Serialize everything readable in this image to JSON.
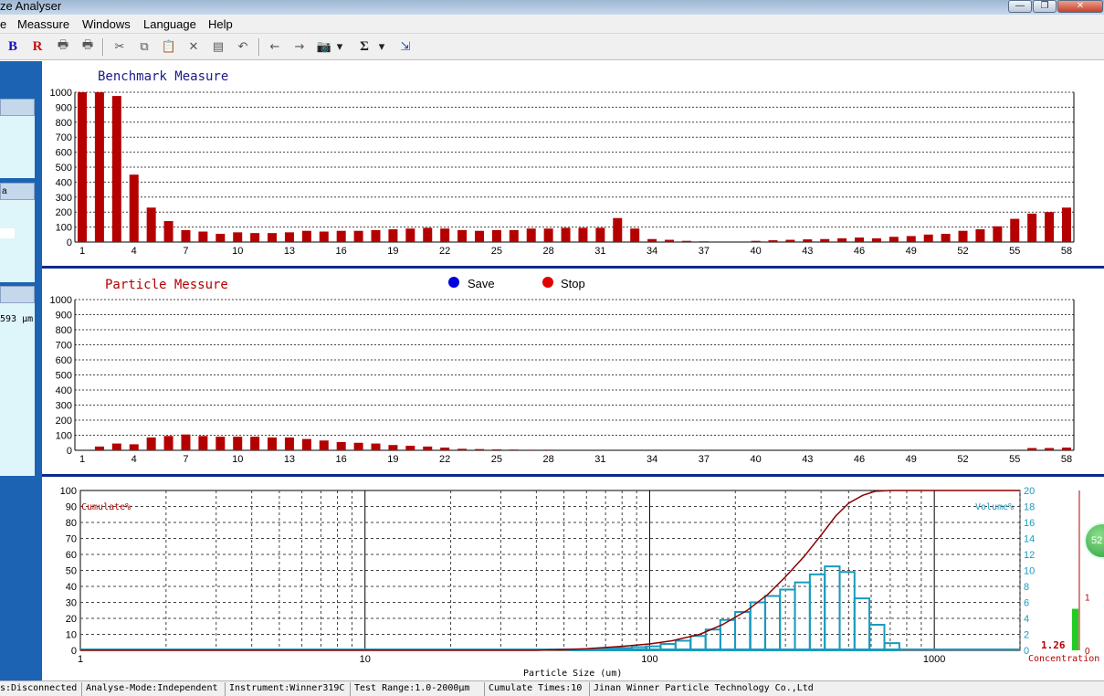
{
  "window": {
    "title": "ze Analyser",
    "buttons": [
      "—",
      "❐",
      "✕"
    ]
  },
  "menu": [
    "e",
    "Meassure",
    "Windows",
    "Language",
    "Help"
  ],
  "toolbar": [
    {
      "icon": "b-letter-icon",
      "label": "B"
    },
    {
      "icon": "r-letter-icon",
      "label": "R"
    },
    {
      "icon": "printer-icon",
      "label": "🖶"
    },
    {
      "icon": "printer-preview-icon",
      "label": "🖶"
    },
    {
      "icon": "cut-icon",
      "label": "✂"
    },
    {
      "icon": "copy-icon",
      "label": "⧉"
    },
    {
      "icon": "paste-icon",
      "label": "📋"
    },
    {
      "icon": "delete-icon",
      "label": "✕"
    },
    {
      "icon": "properties-icon",
      "label": "▤"
    },
    {
      "icon": "undo-icon",
      "label": "↶"
    },
    {
      "icon": "arrow-left-icon",
      "label": "←"
    },
    {
      "icon": "arrow-right-icon",
      "label": "→"
    },
    {
      "icon": "camera-icon",
      "label": "📷"
    },
    {
      "icon": "dropdown-arrow-icon",
      "label": "▾"
    },
    {
      "icon": "sigma-icon",
      "label": "Σ"
    },
    {
      "icon": "dropdown-arrow-icon",
      "label": "▾"
    },
    {
      "icon": "exit-icon",
      "label": "⇲"
    }
  ],
  "left_panel": {
    "head_2": "a",
    "size_text": "593 μm"
  },
  "benchmark": {
    "title": "Benchmark Measure",
    "title_color": "#1a1a8c",
    "bar_color": "#b50000",
    "y_ticks": [
      "0",
      "100",
      "200",
      "300",
      "400",
      "500",
      "600",
      "700",
      "800",
      "900",
      "1000"
    ],
    "x_ticks": [
      "1",
      "4",
      "7",
      "10",
      "13",
      "16",
      "19",
      "22",
      "25",
      "28",
      "31",
      "34",
      "37",
      "40",
      "43",
      "46",
      "49",
      "52",
      "55",
      "58"
    ]
  },
  "particle": {
    "title": "Particle Messure",
    "title_color": "#b50000",
    "save_label": "Save",
    "stop_label": "Stop",
    "save_color": "#0000e0",
    "stop_color": "#e00000",
    "y_ticks": [
      "0",
      "100",
      "200",
      "300",
      "400",
      "500",
      "600",
      "700",
      "800",
      "900",
      "1000"
    ],
    "x_ticks": [
      "1",
      "4",
      "7",
      "10",
      "13",
      "16",
      "19",
      "22",
      "25",
      "28",
      "31",
      "34",
      "37",
      "40",
      "43",
      "46",
      "49",
      "52",
      "55",
      "58"
    ]
  },
  "distribution": {
    "left_axis_label": "Cumulate%",
    "right_axis_label": "Volume%",
    "x_label": "Particle Size (um)",
    "left_ticks": [
      "0",
      "10",
      "20",
      "30",
      "40",
      "50",
      "60",
      "70",
      "80",
      "90",
      "100"
    ],
    "right_ticks": [
      "0",
      "2",
      "4",
      "6",
      "8",
      "10",
      "12",
      "14",
      "16",
      "18",
      "20"
    ],
    "x_ticks": [
      "1",
      "10",
      "100",
      "1000"
    ],
    "cumulate_color": "#8b0000",
    "volume_color": "#1a9bbf"
  },
  "concentration": {
    "value": "1.26",
    "label": "Concentration",
    "ticks": [
      "0",
      "1",
      "2"
    ],
    "bar_color": "#22cc22"
  },
  "green_badge": "52",
  "status": [
    "s:Disconnected",
    "Analyse-Mode:Independent",
    "Instrument:Winner319C",
    "Test Range:1.0-2000μm",
    "Cumulate Times:10",
    "Jinan Winner Particle Technology Co.,Ltd"
  ],
  "chart_data": [
    {
      "type": "bar",
      "title": "Benchmark Measure",
      "categories": [
        1,
        2,
        3,
        4,
        5,
        6,
        7,
        8,
        9,
        10,
        11,
        12,
        13,
        14,
        15,
        16,
        17,
        18,
        19,
        20,
        21,
        22,
        23,
        24,
        25,
        26,
        27,
        28,
        29,
        30,
        31,
        32,
        33,
        34,
        35,
        36,
        37,
        38,
        39,
        40,
        41,
        42,
        43,
        44,
        45,
        46,
        47,
        48,
        49,
        50,
        51,
        52,
        53,
        54,
        55,
        56,
        57,
        58
      ],
      "values": [
        1000,
        1000,
        975,
        450,
        230,
        140,
        80,
        70,
        55,
        65,
        60,
        60,
        65,
        75,
        70,
        75,
        75,
        80,
        85,
        90,
        95,
        90,
        80,
        75,
        80,
        80,
        90,
        90,
        95,
        95,
        95,
        160,
        90,
        20,
        15,
        8,
        5,
        3,
        3,
        8,
        12,
        15,
        18,
        20,
        25,
        30,
        25,
        35,
        40,
        50,
        55,
        75,
        85,
        105,
        155,
        190,
        200,
        230,
        295
      ],
      "ylim": [
        0,
        1000
      ]
    },
    {
      "type": "bar",
      "title": "Particle Messure",
      "categories": [
        1,
        2,
        3,
        4,
        5,
        6,
        7,
        8,
        9,
        10,
        11,
        12,
        13,
        14,
        15,
        16,
        17,
        18,
        19,
        20,
        21,
        22,
        23,
        24,
        25,
        26,
        27,
        28,
        29,
        30,
        31,
        32,
        33,
        34,
        35,
        36,
        37,
        38,
        39,
        40,
        41,
        42,
        43,
        44,
        45,
        46,
        47,
        48,
        49,
        50,
        51,
        52,
        53,
        54,
        55,
        56,
        57,
        58
      ],
      "values": [
        0,
        25,
        45,
        40,
        85,
        95,
        105,
        95,
        90,
        90,
        90,
        85,
        85,
        75,
        65,
        55,
        50,
        45,
        35,
        30,
        25,
        18,
        10,
        8,
        6,
        5,
        4,
        4,
        3,
        2,
        1,
        0,
        0,
        0,
        0,
        0,
        0,
        0,
        0,
        0,
        0,
        0,
        0,
        0,
        0,
        0,
        0,
        0,
        0,
        0,
        0,
        0,
        0,
        0,
        0,
        15,
        15,
        18,
        20
      ],
      "ylim": [
        0,
        1000
      ]
    },
    {
      "type": "bar",
      "title": "",
      "xlabel": "Particle Size (um)",
      "x_scale": "log",
      "xlim": [
        1,
        2000
      ],
      "series": [
        {
          "name": "Volume%",
          "axis": "right",
          "type": "histogram",
          "x": [
            56,
            64,
            72,
            81,
            92,
            103,
            116,
            131,
            148,
            167,
            188,
            212,
            240,
            270,
            305,
            344,
            388,
            438,
            494,
            557,
            629,
            710
          ],
          "values": [
            0.1,
            0.15,
            0.25,
            0.3,
            0.4,
            0.5,
            0.8,
            1.2,
            1.8,
            2.6,
            3.8,
            4.8,
            6.0,
            6.8,
            7.6,
            8.5,
            9.5,
            10.5,
            9.8,
            6.5,
            3.2,
            0.9
          ],
          "ylim": [
            0,
            20
          ]
        },
        {
          "name": "Cumulate%",
          "axis": "left",
          "type": "line",
          "x": [
            1,
            40,
            60,
            80,
            100,
            120,
            150,
            180,
            220,
            260,
            300,
            350,
            400,
            450,
            500,
            560,
            620,
            700,
            2000
          ],
          "values": [
            0,
            0,
            1,
            2.5,
            4,
            6,
            10,
            16,
            25,
            35,
            46,
            59,
            72,
            84,
            92,
            97,
            99.5,
            100,
            100
          ],
          "ylim": [
            0,
            100
          ]
        }
      ]
    },
    {
      "type": "bar",
      "title": "",
      "xlabel": "Concentration",
      "categories": [
        "Concentration"
      ],
      "values": [
        0.52
      ],
      "ylim": [
        0,
        3
      ]
    }
  ]
}
